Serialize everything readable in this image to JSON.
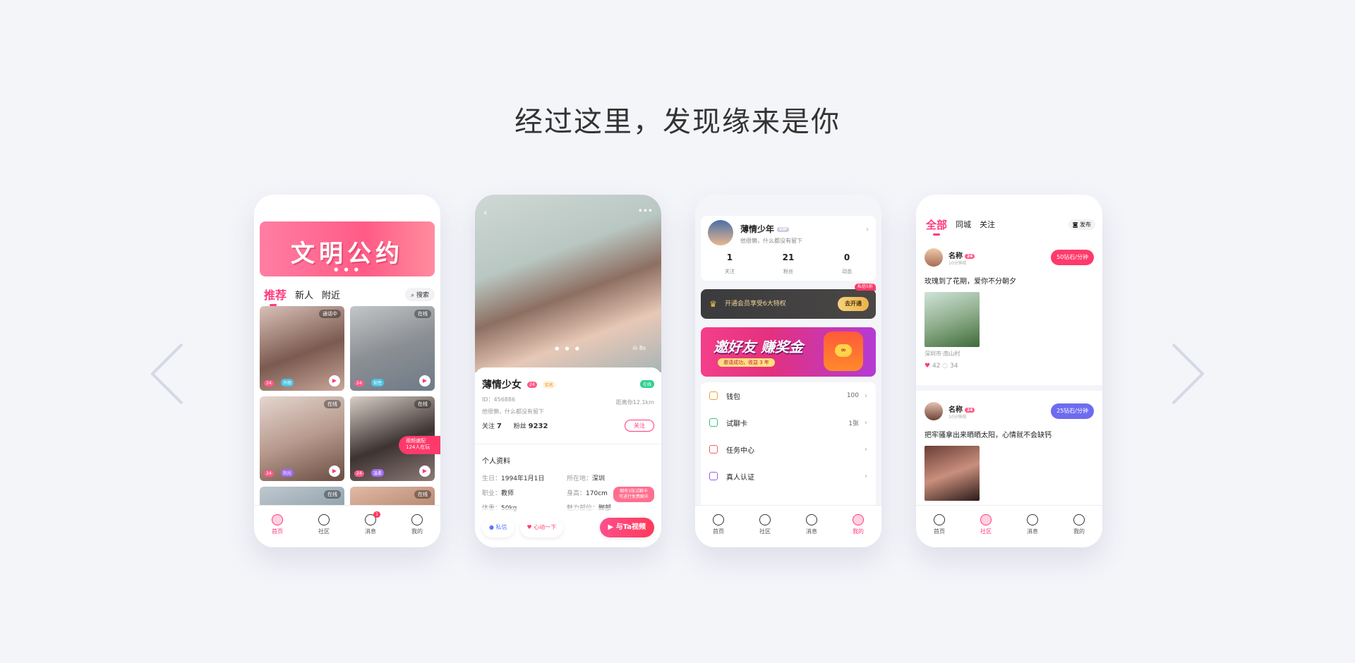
{
  "headline": "经过这里，发现缘来是你",
  "phone1": {
    "banner": "文明公约",
    "banner_dots": "● ● ●",
    "tabs": [
      "推荐",
      "新人",
      "附近"
    ],
    "search": "搜索",
    "video_tag": [
      "视频速配",
      "124人在玩"
    ],
    "cards": [
      {
        "status": "通话中",
        "age": "24",
        "tag": "开朗",
        "bg": "linear-gradient(160deg,#d9c1b8,#7b5a50 55%,#c9a79a)"
      },
      {
        "status": "在线",
        "age": "24",
        "tag": "知性",
        "bg": "linear-gradient(160deg,#c2c6c8,#8b8f93 50%,#6e7a88)"
      },
      {
        "status": "在线",
        "age": "24",
        "tag": "阳光",
        "bg": "linear-gradient(160deg,#e4d6cf,#b89a8e 50%,#6a4d42)"
      },
      {
        "status": "在线",
        "age": "24",
        "tag": "温柔",
        "bg": "linear-gradient(160deg,#d7cfc6,#3d3332 55%,#8c7a76)"
      },
      {
        "status": "在线",
        "age": "",
        "tag": "",
        "bg": "linear-gradient(160deg,#bfc8cf,#8fa0aa)"
      },
      {
        "status": "在线",
        "age": "",
        "tag": "",
        "bg": "linear-gradient(160deg,#e1b9a5,#b58670)"
      }
    ],
    "tabbar": [
      {
        "label": "首页"
      },
      {
        "label": "社区"
      },
      {
        "label": "消息",
        "badge": "1"
      },
      {
        "label": "我的"
      }
    ]
  },
  "phone2": {
    "back": "‹",
    "more": "•••",
    "photo_dots": "● ● ●",
    "sound": "ılı 8s",
    "name": "薄情少女",
    "age": "24",
    "level": "实名",
    "online": "在线",
    "id": "ID：456886",
    "distance": "距离你12.1km",
    "signature": "他很懒，什么都没有留下",
    "follow_label": "关注",
    "follow_count": "7",
    "fans_label": "粉丝",
    "fans_count": "9232",
    "follow_btn": "关注",
    "section": "个人资料",
    "info": [
      {
        "k": "生日：",
        "v": "1994年1月1日"
      },
      {
        "k": "所在地：",
        "v": "深圳"
      },
      {
        "k": "职业：",
        "v": "教师"
      },
      {
        "k": "身高：",
        "v": "170cm"
      },
      {
        "k": "体重：",
        "v": "50kg"
      },
      {
        "k": "魅力部位：",
        "v": "脚部"
      }
    ],
    "tip": [
      "拥有3张试聊卡",
      "可进行免费聊天"
    ],
    "btn_chat": "私信",
    "btn_heart": "心动一下",
    "btn_video": "与Ta视频"
  },
  "phone3": {
    "name": "薄情少年",
    "vip": "VIP",
    "signature": "他很懒，什么都没有留下",
    "stats": [
      {
        "v": "1",
        "l": "关注"
      },
      {
        "v": "21",
        "l": "粉丝"
      },
      {
        "v": "0",
        "l": "动态"
      }
    ],
    "vip_text": "开通会员享受6大特权",
    "vip_btn": "去开通",
    "vip_tag": "私信5折",
    "invite_title": "邀好友 赚奖金",
    "invite_sub": "邀请成功，收益 3 年",
    "invite_dots": "● ● ●",
    "menu": [
      {
        "label": "钱包",
        "value": "100",
        "color": "#f0a030"
      },
      {
        "label": "试聊卡",
        "value": "1张",
        "color": "#3cbf7a"
      },
      {
        "label": "任务中心",
        "value": "",
        "color": "#ff5a5a"
      },
      {
        "label": "真人认证",
        "value": "",
        "color": "#9b5cf0"
      }
    ],
    "tabbar": [
      {
        "label": "首页"
      },
      {
        "label": "社区"
      },
      {
        "label": "消息"
      },
      {
        "label": "我的"
      }
    ]
  },
  "phone4": {
    "tabs": [
      "全部",
      "同城",
      "关注"
    ],
    "publish": "发布",
    "posts": [
      {
        "name": "名称",
        "age": "24",
        "time": "10分钟前",
        "price": "50钻石/分钟",
        "price_color": "#ff3a6a",
        "text": "玫瑰到了花期，爱你不分朝夕",
        "location": "深圳市·南山村",
        "likes": "42",
        "comments": "34",
        "pic": "linear-gradient(160deg,#cfe3d9,#8fae8c 50%,#3f6b3a)",
        "avatar": "linear-gradient(#f0c9a8,#a56d55)"
      },
      {
        "name": "名称",
        "age": "24",
        "time": "10分钟前",
        "price": "25钻石/分钟",
        "price_color": "#6d6cf0",
        "text": "把牢骚拿出来晒晒太阳，心情就不会缺钙",
        "pic": "linear-gradient(160deg,#6a3d36,#c98f7d 50%,#2b1a17)",
        "avatar": "linear-gradient(#e8c3b0,#6b4437)"
      }
    ],
    "tabbar": [
      {
        "label": "首页"
      },
      {
        "label": "社区"
      },
      {
        "label": "消息"
      },
      {
        "label": "我的"
      }
    ]
  }
}
